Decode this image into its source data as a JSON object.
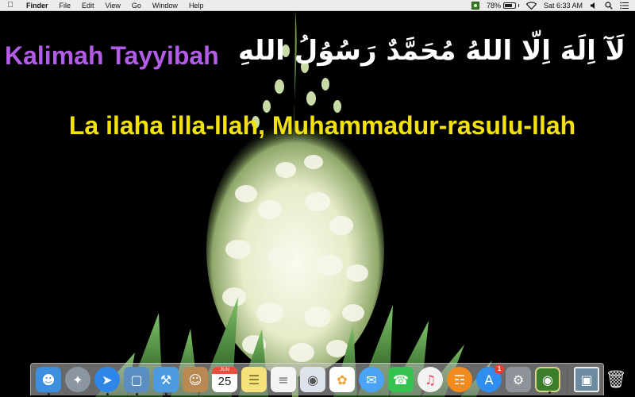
{
  "menubar": {
    "apple_icon": "apple-logo-icon",
    "app_name": "Finder",
    "menus": [
      "File",
      "Edit",
      "View",
      "Go",
      "Window",
      "Help"
    ],
    "battery_percent": "78%",
    "battery_level": 0.78,
    "clock": "Sat 6:33 AM"
  },
  "desktop": {
    "title_latin": "Kalimah Tayyibah",
    "title_arabic": "لَآ اِلَهَ اِلّا اللهُ مُحَمَّدٌ رَسُوُلُ اللهِ",
    "transliteration": "La ilaha illa-llah, Muhammadur-rasulu-llah",
    "colors": {
      "latin_title": "#b35ce8",
      "arabic_title": "#ffffff",
      "transliteration": "#f2e10f"
    }
  },
  "dock": {
    "calendar": {
      "month": "JUN",
      "day": "25"
    },
    "app_store_badge": "1",
    "apps": [
      {
        "icon": "finder-icon",
        "color": "#3d8fe0",
        "running": true
      },
      {
        "icon": "launchpad-icon",
        "color": "#8c96a3",
        "running": false
      },
      {
        "icon": "safari-icon",
        "color": "#2d86e8",
        "running": true
      },
      {
        "icon": "preview-icon",
        "color": "#5a8ec2",
        "running": true
      },
      {
        "icon": "xcode-icon",
        "color": "#4c9be0",
        "running": true
      },
      {
        "icon": "contacts-icon",
        "color": "#b88a52",
        "running": false
      },
      {
        "icon": "calendar-icon",
        "color": "#ffffff",
        "running": false
      },
      {
        "icon": "notes-icon",
        "color": "#f6e27a",
        "running": false
      },
      {
        "icon": "reminders-icon",
        "color": "#f4f4f4",
        "running": false
      },
      {
        "icon": "photo-booth-icon",
        "color": "#dde3ea",
        "running": false
      },
      {
        "icon": "photos-icon",
        "color": "#ffffff",
        "running": false
      },
      {
        "icon": "messages-icon",
        "color": "#4ba3f5",
        "running": false
      },
      {
        "icon": "facetime-icon",
        "color": "#36c24f",
        "running": false
      },
      {
        "icon": "itunes-icon",
        "color": "#f2f2f2",
        "running": false
      },
      {
        "icon": "ibooks-icon",
        "color": "#f28c1e",
        "running": false
      },
      {
        "icon": "app-store-icon",
        "color": "#2f8ff0",
        "running": false
      },
      {
        "icon": "system-preferences-icon",
        "color": "#8e9399",
        "running": false
      },
      {
        "icon": "kalimah-app-icon",
        "color": "#3a7d2a",
        "running": true
      }
    ]
  }
}
